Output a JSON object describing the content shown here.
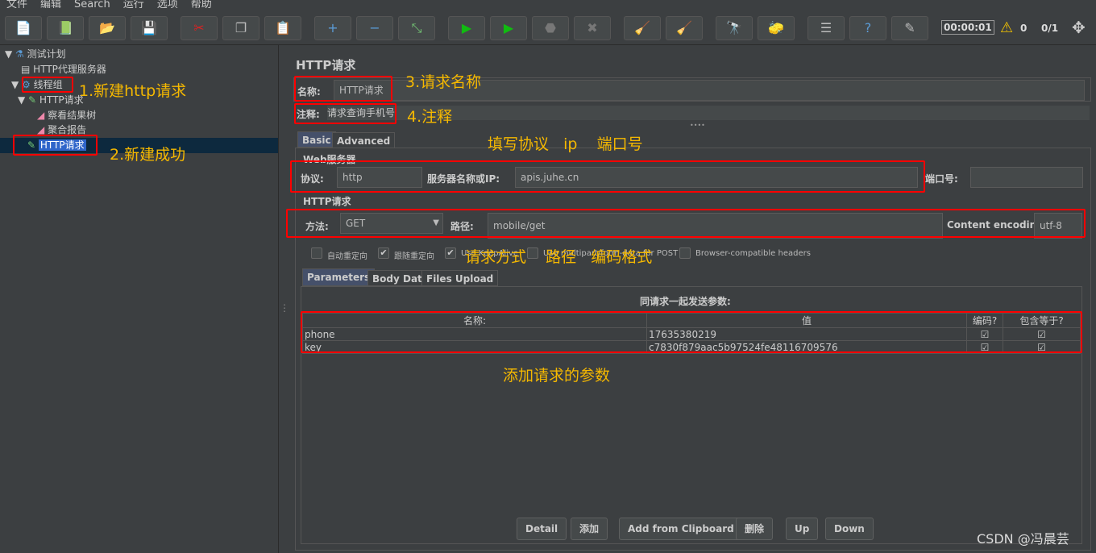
{
  "menu": [
    "文件",
    "编辑",
    "Search",
    "运行",
    "选项",
    "帮助"
  ],
  "toolbar": {
    "icons": [
      "new-icon",
      "templates-icon",
      "open-icon",
      "save-icon",
      "cut-icon",
      "copy-icon",
      "paste-icon",
      "expand-icon",
      "collapse-icon",
      "toggle-icon",
      "start-icon",
      "start-no-pause-icon",
      "stop-icon",
      "shutdown-icon",
      "clear-icon",
      "clear-all-icon",
      "search-icon",
      "reset-search-icon",
      "function-helper-icon",
      "help-icon",
      "remote-icon"
    ],
    "timer": "00:00:01",
    "warnings": "0",
    "threads": "0/1"
  },
  "tree": {
    "items": [
      "测试计划",
      "HTTP代理服务器",
      "线程组",
      "HTTP请求",
      "察看结果树",
      "聚合报告",
      "HTTP请求"
    ]
  },
  "annotations": {
    "a1": "1.新建http请求",
    "a2": "2.新建成功",
    "a3": "3.请求名称",
    "a4": "4.注释",
    "a5": "填写协议   ip    端口号",
    "a6": "请求方式    路径   编码格式",
    "a7": "添加请求的参数"
  },
  "panel": {
    "title": "HTTP请求",
    "name_label": "名称:",
    "name_value": "HTTP请求",
    "comment_label": "注释:",
    "comment_value": "请求查询手机号",
    "tabs": [
      "Basic",
      "Advanced"
    ],
    "web_server_legend": "Web服务器",
    "protocol_label": "协议:",
    "protocol_value": "http",
    "server_label": "服务器名称或IP:",
    "server_value": "apis.juhe.cn",
    "port_label": "端口号:",
    "port_value": "",
    "http_legend": "HTTP请求",
    "method_label": "方法:",
    "method_value": "GET",
    "path_label": "路径:",
    "path_value": "mobile/get",
    "encoding_label": "Content encoding:",
    "encoding_value": "utf-8",
    "checkboxes": [
      {
        "label": "自动重定向",
        "checked": false
      },
      {
        "label": "跟随重定向",
        "checked": true
      },
      {
        "label": "Use KeepAlive",
        "checked": true
      },
      {
        "label": "Use multipart/form-data for POST",
        "checked": false
      },
      {
        "label": "Browser-compatible headers",
        "checked": false
      }
    ],
    "param_tabs": [
      "Parameters",
      "Body Data",
      "Files Upload"
    ],
    "params_caption": "同请求一起发送参数:",
    "columns": [
      "名称:",
      "值",
      "编码?",
      "包含等于?"
    ],
    "rows": [
      {
        "name": "phone",
        "value": "17635380219",
        "encode": true,
        "include_equals": true
      },
      {
        "name": "key",
        "value": "c7830f879aac5b97524fe48116709576",
        "encode": true,
        "include_equals": true
      }
    ],
    "buttons": [
      "Detail",
      "添加",
      "Add from Clipboard",
      "删除",
      "Up",
      "Down"
    ]
  },
  "watermark": "CSDN @冯晨芸"
}
